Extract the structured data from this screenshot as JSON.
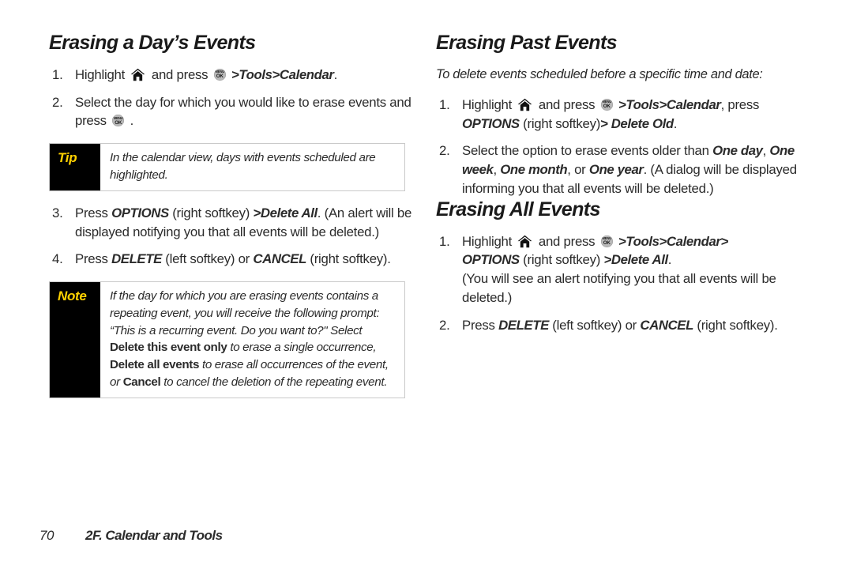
{
  "page": {
    "background": "#ffffff",
    "accent_label_bg": "#000000",
    "accent_label_fg": "#ffd100"
  },
  "left_column": {
    "heading": "Erasing a Day’s Events",
    "steps": [
      {
        "num": "1.",
        "parts": [
          {
            "t": "text",
            "v": "Highlight "
          },
          {
            "t": "icon",
            "v": "home-icon"
          },
          {
            "t": "text",
            "v": " and press "
          },
          {
            "t": "icon",
            "v": "menu-ok-icon"
          },
          {
            "t": "bolditalic",
            "v": " >Tools>Calendar"
          },
          {
            "t": "text",
            "v": "."
          }
        ]
      },
      {
        "num": "2.",
        "parts": [
          {
            "t": "text",
            "v": "Select the day for which you would like to erase events and press "
          },
          {
            "t": "icon",
            "v": "menu-ok-icon"
          },
          {
            "t": "text",
            "v": " ."
          }
        ]
      }
    ],
    "tip_box": {
      "label": "Tip",
      "body": "In the calendar view, days with events scheduled are highlighted."
    },
    "steps_after_tip": [
      {
        "num": "3.",
        "parts": [
          {
            "t": "text",
            "v": "Press "
          },
          {
            "t": "bolditalic",
            "v": "OPTIONS"
          },
          {
            "t": "text",
            "v": " (right softkey) "
          },
          {
            "t": "bolditalic",
            "v": ">Delete All"
          },
          {
            "t": "text",
            "v": ". (An alert will be displayed notifying you that all events will be deleted.)"
          }
        ]
      },
      {
        "num": "4.",
        "parts": [
          {
            "t": "text",
            "v": "Press "
          },
          {
            "t": "bolditalic",
            "v": "DELETE"
          },
          {
            "t": "text",
            "v": " (left softkey) or "
          },
          {
            "t": "bolditalic",
            "v": "CANCEL"
          },
          {
            "t": "text",
            "v": " (right softkey)."
          }
        ]
      }
    ],
    "note_box": {
      "label": "Note",
      "segments": [
        {
          "t": "italic",
          "v": "If the day for which you are erasing events contains a repeating event, you will receive the following prompt: “This is a recurring event. Do you want to?\" Select "
        },
        {
          "t": "bold",
          "v": "Delete this event only"
        },
        {
          "t": "italic",
          "v": " to erase a single occurrence, "
        },
        {
          "t": "bold",
          "v": "Delete all events"
        },
        {
          "t": "italic",
          "v": " to erase all occurrences of the event, or "
        },
        {
          "t": "bold",
          "v": "Cancel"
        },
        {
          "t": "italic",
          "v": " to cancel the deletion of the repeating event."
        }
      ]
    }
  },
  "right_column": {
    "heading_past": "Erasing Past Events",
    "lead_past": "To delete events scheduled before a specific time and date:",
    "steps_past": [
      {
        "num": "1.",
        "parts": [
          {
            "t": "text",
            "v": "Highlight "
          },
          {
            "t": "icon",
            "v": "home-icon"
          },
          {
            "t": "text",
            "v": " and press "
          },
          {
            "t": "icon",
            "v": "menu-ok-icon"
          },
          {
            "t": "bolditalic",
            "v": " >Tools>Calendar"
          },
          {
            "t": "text",
            "v": ", press "
          },
          {
            "t": "bolditalic",
            "v": "OPTIONS"
          },
          {
            "t": "text",
            "v": " (right softkey)"
          },
          {
            "t": "bolditalic",
            "v": "> Delete Old"
          },
          {
            "t": "text",
            "v": "."
          }
        ]
      },
      {
        "num": "2.",
        "parts": [
          {
            "t": "text",
            "v": "Select the option to erase events older than "
          },
          {
            "t": "bolditalic",
            "v": "One day"
          },
          {
            "t": "text",
            "v": ", "
          },
          {
            "t": "bolditalic",
            "v": "One week"
          },
          {
            "t": "text",
            "v": ", "
          },
          {
            "t": "bolditalic",
            "v": "One month"
          },
          {
            "t": "text",
            "v": ", or "
          },
          {
            "t": "bolditalic",
            "v": "One year"
          },
          {
            "t": "text",
            "v": ". (A dialog will be displayed informing you that all events will be deleted.)"
          }
        ]
      }
    ],
    "heading_all": "Erasing All Events",
    "steps_all": [
      {
        "num": "1.",
        "parts": [
          {
            "t": "text",
            "v": "Highlight "
          },
          {
            "t": "icon",
            "v": "home-icon"
          },
          {
            "t": "text",
            "v": " and press "
          },
          {
            "t": "icon",
            "v": "menu-ok-icon"
          },
          {
            "t": "bolditalic",
            "v": " >Tools>Calendar>"
          },
          {
            "t": "break",
            "v": ""
          },
          {
            "t": "bolditalic",
            "v": "OPTIONS"
          },
          {
            "t": "text",
            "v": " (right softkey) "
          },
          {
            "t": "bolditalic",
            "v": ">Delete All"
          },
          {
            "t": "text",
            "v": "."
          },
          {
            "t": "break",
            "v": ""
          },
          {
            "t": "text",
            "v": "(You will see an alert notifying you that all events will be deleted.)"
          }
        ]
      },
      {
        "num": "2.",
        "parts": [
          {
            "t": "text",
            "v": "Press "
          },
          {
            "t": "bolditalic",
            "v": "DELETE"
          },
          {
            "t": "text",
            "v": " (left softkey) or "
          },
          {
            "t": "bolditalic",
            "v": "CANCEL"
          },
          {
            "t": "text",
            "v": " (right softkey)."
          }
        ]
      }
    ]
  },
  "footer": {
    "page_number": "70",
    "chapter_title": "2F. Calendar and Tools"
  },
  "icons": {
    "home-icon": "home",
    "menu-ok-icon": {
      "top": "MENU",
      "bottom": "OK"
    }
  }
}
